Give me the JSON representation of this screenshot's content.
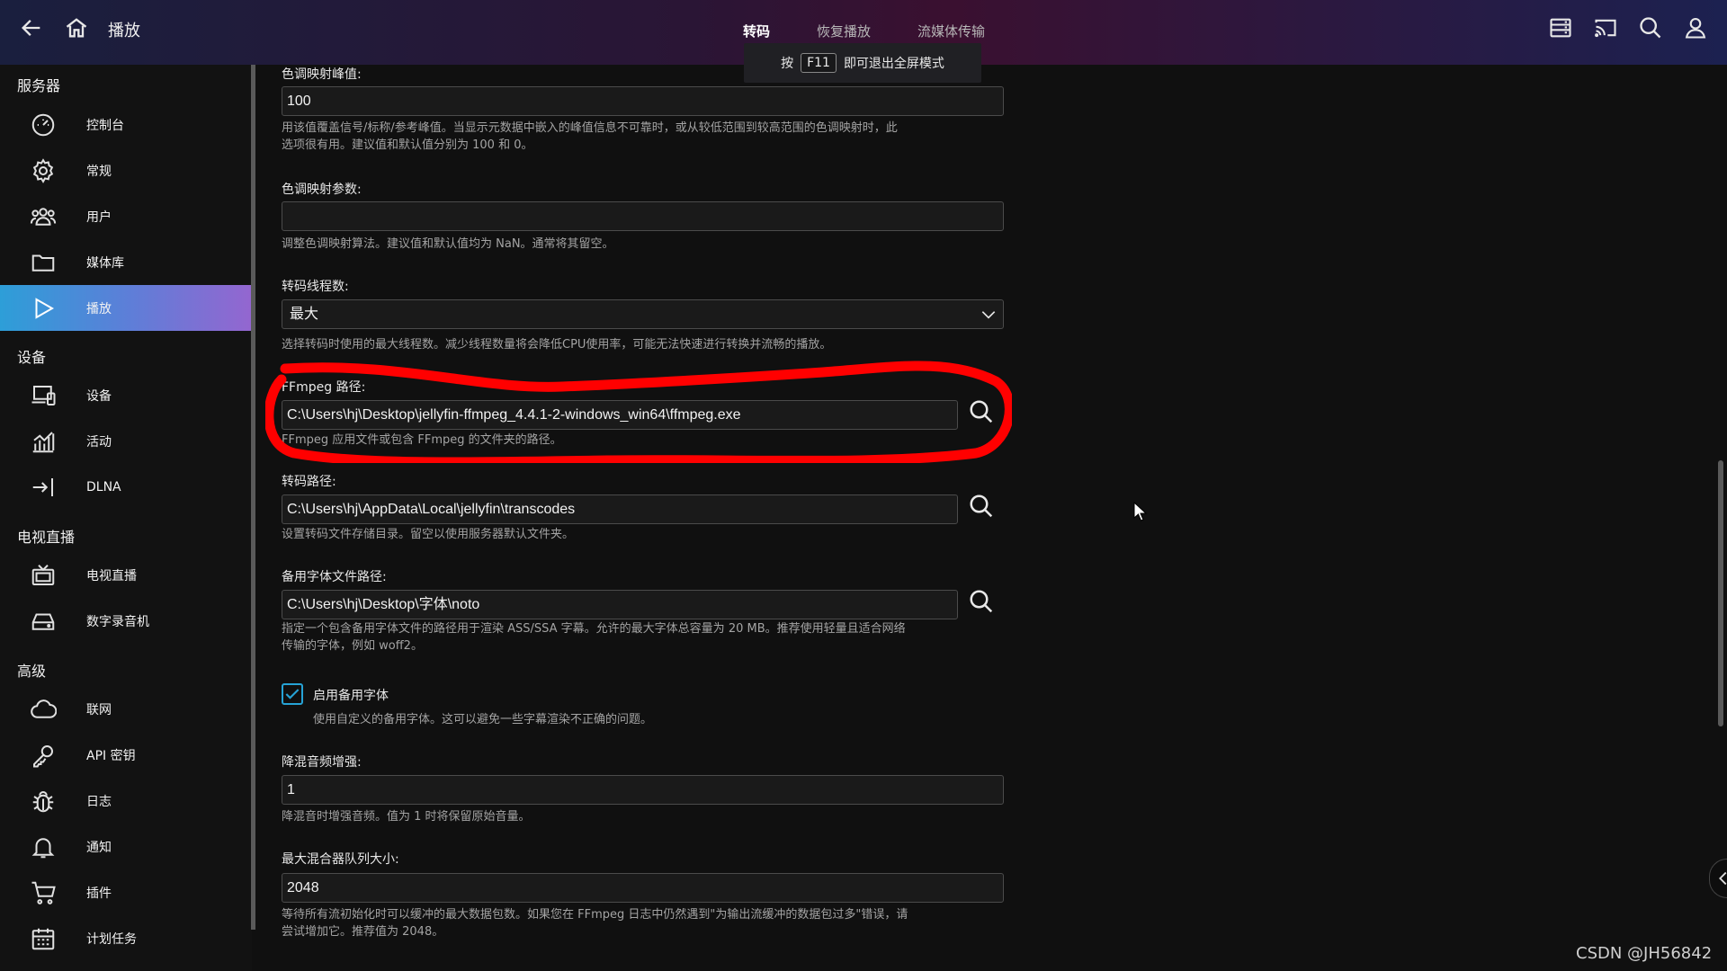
{
  "header": {
    "title": "播放",
    "tabs": [
      "转码",
      "恢复播放",
      "流媒体传输"
    ],
    "toast": {
      "prefix": "按",
      "key": "F11",
      "suffix": "即可退出全屏模式"
    }
  },
  "sidebar": {
    "sections": [
      {
        "title": "服务器",
        "items": [
          {
            "label": "控制台",
            "icon": "dashboard-icon"
          },
          {
            "label": "常规",
            "icon": "gear-icon"
          },
          {
            "label": "用户",
            "icon": "users-icon"
          },
          {
            "label": "媒体库",
            "icon": "folder-icon"
          },
          {
            "label": "播放",
            "icon": "play-icon",
            "active": true
          }
        ]
      },
      {
        "title": "设备",
        "items": [
          {
            "label": "设备",
            "icon": "devices-icon"
          },
          {
            "label": "活动",
            "icon": "activity-chart-icon"
          },
          {
            "label": "DLNA",
            "icon": "login-arrow-icon"
          }
        ]
      },
      {
        "title": "电视直播",
        "items": [
          {
            "label": "电视直播",
            "icon": "tv-icon"
          },
          {
            "label": "数字录音机",
            "icon": "dvr-icon"
          }
        ]
      },
      {
        "title": "高级",
        "items": [
          {
            "label": "联网",
            "icon": "cloud-icon"
          },
          {
            "label": "API 密钥",
            "icon": "key-icon"
          },
          {
            "label": "日志",
            "icon": "bug-icon"
          },
          {
            "label": "通知",
            "icon": "bell-icon"
          },
          {
            "label": "插件",
            "icon": "cart-icon"
          },
          {
            "label": "计划任务",
            "icon": "calendar-icon"
          }
        ]
      }
    ]
  },
  "form": {
    "tonemap_peak": {
      "label": "色调映射峰值:",
      "value": "100",
      "desc1": "用该值覆盖信号/标称/参考峰值。当显示元数据中嵌入的峰值信息不可靠时，或从较低范围到较高范围的色调映射时，此",
      "desc2": "选项很有用。建议值和默认值分别为 100 和 0。"
    },
    "tonemap_param": {
      "label": "色调映射参数:",
      "value": "",
      "desc": "调整色调映射算法。建议值和默认值均为 NaN。通常将其留空。"
    },
    "threads": {
      "label": "转码线程数:",
      "value": "最大",
      "desc": "选择转码时使用的最大线程数。减少线程数量将会降低CPU使用率，可能无法快速进行转换并流畅的播放。"
    },
    "ffmpeg": {
      "label": "FFmpeg 路径:",
      "value": "C:\\Users\\hj\\Desktop\\jellyfin-ffmpeg_4.4.1-2-windows_win64\\ffmpeg.exe",
      "desc": "FFmpeg 应用文件或包含 FFmpeg 的文件夹的路径。"
    },
    "transcode_path": {
      "label": "转码路径:",
      "value": "C:\\Users\\hj\\AppData\\Local\\jellyfin\\transcodes",
      "desc": "设置转码文件存储目录。留空以使用服务器默认文件夹。"
    },
    "fallback_font": {
      "label": "备用字体文件路径:",
      "value": "C:\\Users\\hj\\Desktop\\字体\\noto",
      "desc1": "指定一个包含备用字体文件的路径用于渲染 ASS/SSA 字幕。允许的最大字体总容量为 20 MB。推荐使用轻量且适合网络",
      "desc2": "传输的字体，例如 woff2。"
    },
    "enable_fallback": {
      "label": "启用备用字体",
      "checked": true,
      "desc": "使用自定义的备用字体。这可以避免一些字幕渲染不正确的问题。"
    },
    "downmix": {
      "label": "降混音频增强:",
      "value": "1",
      "desc": "降混音时增强音频。值为 1 时将保留原始音量。"
    },
    "muxer_queue": {
      "label": "最大混合器队列大小:",
      "value": "2048",
      "desc1": "等待所有流初始化时可以缓冲的最大数据包数。如果您在 FFmpeg 日志中仍然遇到\"为输出流缓冲的数据包过多\"错误，请",
      "desc2": "尝试增加它。推荐值为 2048。"
    }
  },
  "watermark": "CSDN @JH56842",
  "colors": {
    "accent": "#26a3d6",
    "annotation": "#ff0000"
  }
}
